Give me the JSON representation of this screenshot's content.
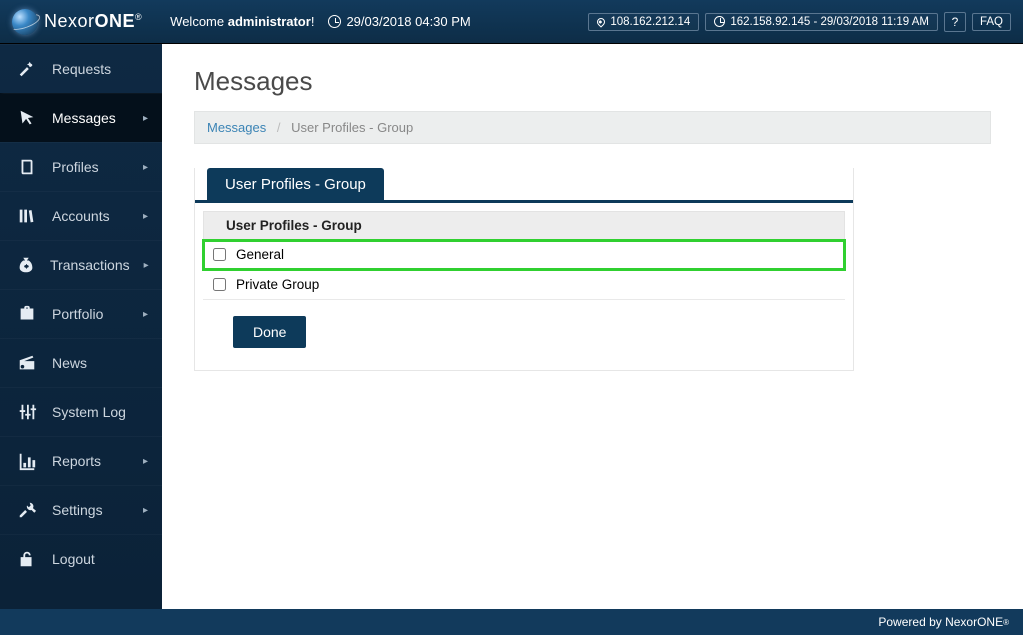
{
  "brand": {
    "name_a": "Nexor",
    "name_b": "ONE",
    "reg": "®"
  },
  "header": {
    "welcome_prefix": "Welcome ",
    "welcome_user": "administrator",
    "welcome_suffix": "!",
    "datetime": "29/03/2018 04:30 PM",
    "ip_current": "108.162.212.14",
    "ip_last": "162.158.92.145 - 29/03/2018 11:19 AM",
    "help": "?",
    "faq": "FAQ"
  },
  "sidebar": {
    "items": [
      {
        "label": "Requests",
        "icon": "wand",
        "expandable": false
      },
      {
        "label": "Messages",
        "icon": "cursor",
        "expandable": true
      },
      {
        "label": "Profiles",
        "icon": "book",
        "expandable": true
      },
      {
        "label": "Accounts",
        "icon": "books",
        "expandable": true
      },
      {
        "label": "Transactions",
        "icon": "moneybag",
        "expandable": true
      },
      {
        "label": "Portfolio",
        "icon": "briefcase",
        "expandable": true
      },
      {
        "label": "News",
        "icon": "radio",
        "expandable": false
      },
      {
        "label": "System Log",
        "icon": "sliders",
        "expandable": false
      },
      {
        "label": "Reports",
        "icon": "chart",
        "expandable": true
      },
      {
        "label": "Settings",
        "icon": "tools",
        "expandable": true
      },
      {
        "label": "Logout",
        "icon": "lock",
        "expandable": false
      }
    ],
    "active_index": 1
  },
  "page": {
    "title": "Messages",
    "breadcrumb": {
      "root": "Messages",
      "current": "User Profiles - Group"
    },
    "tab_label": "User Profiles - Group",
    "table_header": "User Profiles - Group",
    "rows": [
      {
        "label": "General",
        "checked": false,
        "highlight": true
      },
      {
        "label": "Private Group",
        "checked": false,
        "highlight": false
      }
    ],
    "done_label": "Done"
  },
  "footer": {
    "text": "Powered by NexorONE",
    "reg": "®"
  }
}
